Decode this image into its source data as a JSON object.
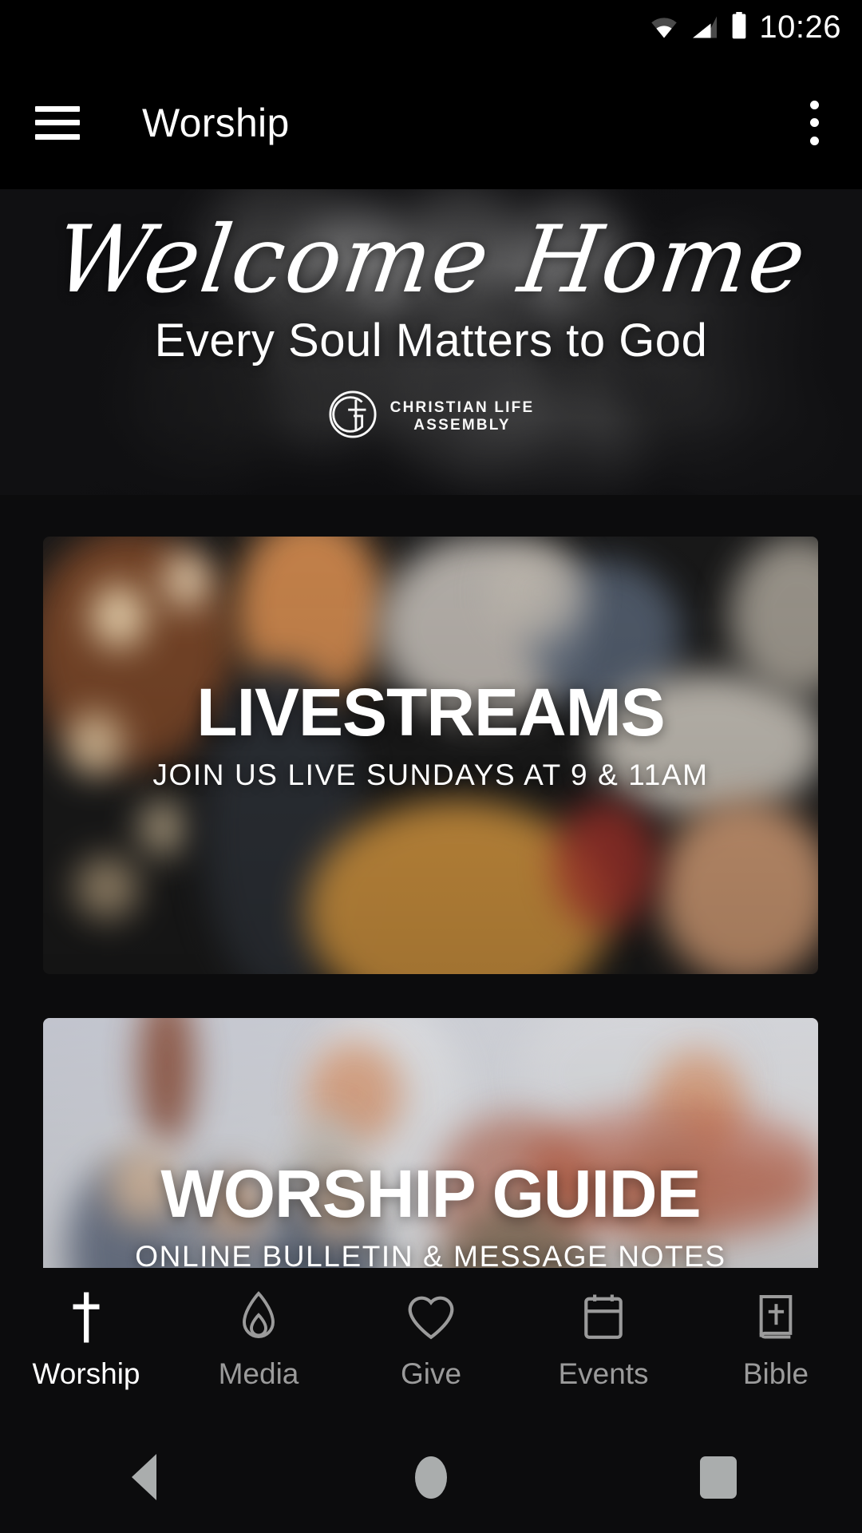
{
  "status_bar": {
    "time": "10:26",
    "icons": [
      "wifi-icon",
      "cellular-signal-icon",
      "battery-icon"
    ]
  },
  "app_bar": {
    "menu_icon": "hamburger-menu-icon",
    "title": "Worship",
    "overflow_icon": "overflow-menu-icon"
  },
  "hero": {
    "script_title": "Welcome Home",
    "subtitle": "Every Soul Matters to God",
    "logo_icon": "christian-life-assembly-logo",
    "logo_line1": "CHRISTIAN LIFE",
    "logo_line2": "ASSEMBLY"
  },
  "cards": [
    {
      "title": "LIVESTREAMS",
      "subtitle": "JOIN US LIVE SUNDAYS AT 9 & 11AM"
    },
    {
      "title": "WORSHIP GUIDE",
      "subtitle": "ONLINE BULLETIN & MESSAGE NOTES"
    }
  ],
  "bottom_nav": {
    "active_index": 0,
    "items": [
      {
        "label": "Worship",
        "icon": "cross-icon"
      },
      {
        "label": "Media",
        "icon": "flame-icon"
      },
      {
        "label": "Give",
        "icon": "heart-icon"
      },
      {
        "label": "Events",
        "icon": "calendar-icon"
      },
      {
        "label": "Bible",
        "icon": "bible-book-icon"
      }
    ]
  },
  "android_nav": {
    "back": "back-triangle-icon",
    "home": "home-circle-icon",
    "recents": "recents-square-icon"
  },
  "colors": {
    "background": "#0c0c0d",
    "bar_background": "#000000",
    "active_text": "#ffffff",
    "inactive_text": "#9b9b9b",
    "system_icon": "#aaadad"
  }
}
